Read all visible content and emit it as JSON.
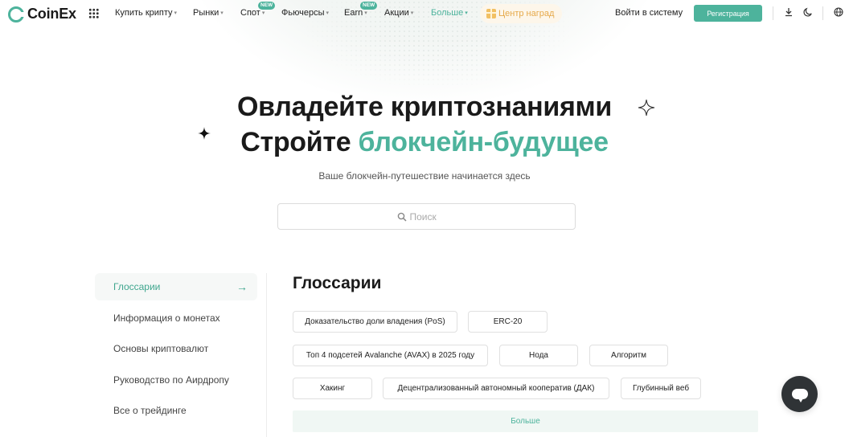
{
  "brand": {
    "name": "CoinEx",
    "accent": "#4db39c"
  },
  "nav": {
    "items": [
      {
        "label": "Купить крипту",
        "caret": "▾",
        "badge": ""
      },
      {
        "label": "Рынки",
        "caret": "▾",
        "badge": ""
      },
      {
        "label": "Спот",
        "caret": "▾",
        "badge": "NEW"
      },
      {
        "label": "Фьючерсы",
        "caret": "▾",
        "badge": ""
      },
      {
        "label": "Earn",
        "caret": "▾",
        "badge": "NEW"
      },
      {
        "label": "Акции",
        "caret": "▾",
        "badge": ""
      },
      {
        "label": "Больше",
        "caret": "▾",
        "badge": ""
      }
    ],
    "rewards_label": "Центр наград",
    "login_label": "Войти в систему",
    "register_label": "Регистрация",
    "icons": [
      "apps-grid-icon",
      "download-icon",
      "moon-icon",
      "globe-icon"
    ]
  },
  "hero": {
    "line1": "Овладейте криптознаниями",
    "line2_plain": "Стройте ",
    "line2_accent": "блокчейн-будущее",
    "subtitle": "Ваше блокчейн-путешествие начинается здесь"
  },
  "search": {
    "placeholder": "Поиск",
    "value": ""
  },
  "sidebar": {
    "items": [
      {
        "label": "Глоссарии",
        "active": true
      },
      {
        "label": "Информация о монетах",
        "active": false
      },
      {
        "label": "Основы криптовалют",
        "active": false
      },
      {
        "label": "Руководство по Аирдропу",
        "active": false
      },
      {
        "label": "Все о трейдинге",
        "active": false
      }
    ],
    "active_arrow": "→"
  },
  "glossary": {
    "title": "Глоссарии",
    "chips": [
      "Доказательство доли владения (PoS)",
      "ERC-20",
      "Топ 4 подсетей Avalanche (AVAX) в 2025 году",
      "Нода",
      "Алгоритм",
      "Хакинг",
      "Децентрализованный автономный кооператив (ДАК)",
      "Глубинный веб"
    ],
    "more_label": "Больше"
  },
  "chat": {
    "icon": "chat-icon"
  }
}
